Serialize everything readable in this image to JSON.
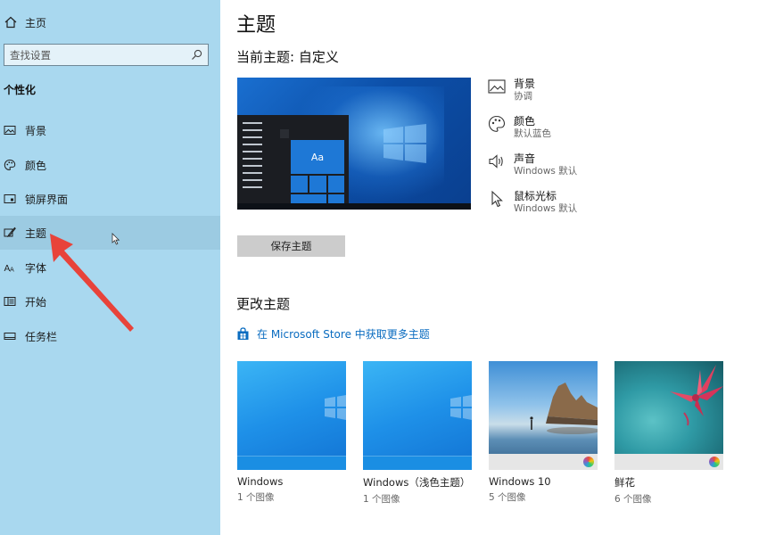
{
  "sidebar": {
    "home_label": "主页",
    "search_placeholder": "查找设置",
    "section_title": "个性化",
    "items": [
      {
        "label": "背景"
      },
      {
        "label": "颜色"
      },
      {
        "label": "锁屏界面"
      },
      {
        "label": "主题"
      },
      {
        "label": "字体"
      },
      {
        "label": "开始"
      },
      {
        "label": "任务栏"
      }
    ],
    "active_index": 3
  },
  "main": {
    "title": "主题",
    "current_theme": "当前主题: 自定义",
    "preview_tile_text": "Aa",
    "properties": [
      {
        "title": "背景",
        "subtitle": "协调",
        "icon": "image-icon"
      },
      {
        "title": "颜色",
        "subtitle": "默认蓝色",
        "icon": "palette-icon"
      },
      {
        "title": "声音",
        "subtitle": "Windows 默认",
        "icon": "speaker-icon"
      },
      {
        "title": "鼠标光标",
        "subtitle": "Windows 默认",
        "icon": "pointer-icon"
      }
    ],
    "save_button": "保存主题",
    "change_title": "更改主题",
    "store_link": "在 Microsoft Store 中获取更多主题",
    "themes": [
      {
        "name": "Windows",
        "count": "1 个图像"
      },
      {
        "name": "Windows（浅色主题）",
        "count": "1 个图像"
      },
      {
        "name": "Windows 10",
        "count": "5 个图像"
      },
      {
        "name": "鲜花",
        "count": "6 个图像"
      }
    ]
  },
  "colors": {
    "sidebar_bg": "#a9d8ef",
    "accent_link": "#0a6cc0",
    "annotation_arrow": "#e8433a"
  }
}
